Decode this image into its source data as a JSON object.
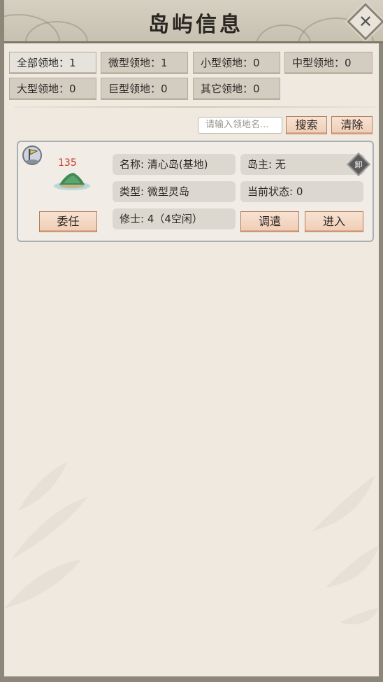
{
  "title": "岛屿信息",
  "filters": [
    {
      "label": "全部领地：1"
    },
    {
      "label": "微型领地：1"
    },
    {
      "label": "小型领地：0"
    },
    {
      "label": "中型领地：0"
    },
    {
      "label": "大型领地：0"
    },
    {
      "label": "巨型领地：0"
    },
    {
      "label": "其它领地：0"
    }
  ],
  "search": {
    "placeholder": "请输入领地名...",
    "search_label": "搜索",
    "clear_label": "清除"
  },
  "territory": {
    "value": "135",
    "name": "名称:  清心岛(基地)",
    "owner": "岛主:  无",
    "owner_badge": "卸",
    "type": "类型:  微型灵岛",
    "status": "当前状态:   0",
    "cultivators": "修士:  4（4空闲）",
    "appoint_label": "委任",
    "dispatch_label": "调遣",
    "enter_label": "进入"
  },
  "colors": {
    "accent": "#f0cdb5",
    "value_red": "#c8321e"
  },
  "icons": {
    "close": "close-icon",
    "flag": "flag-icon",
    "island": "island-icon"
  }
}
